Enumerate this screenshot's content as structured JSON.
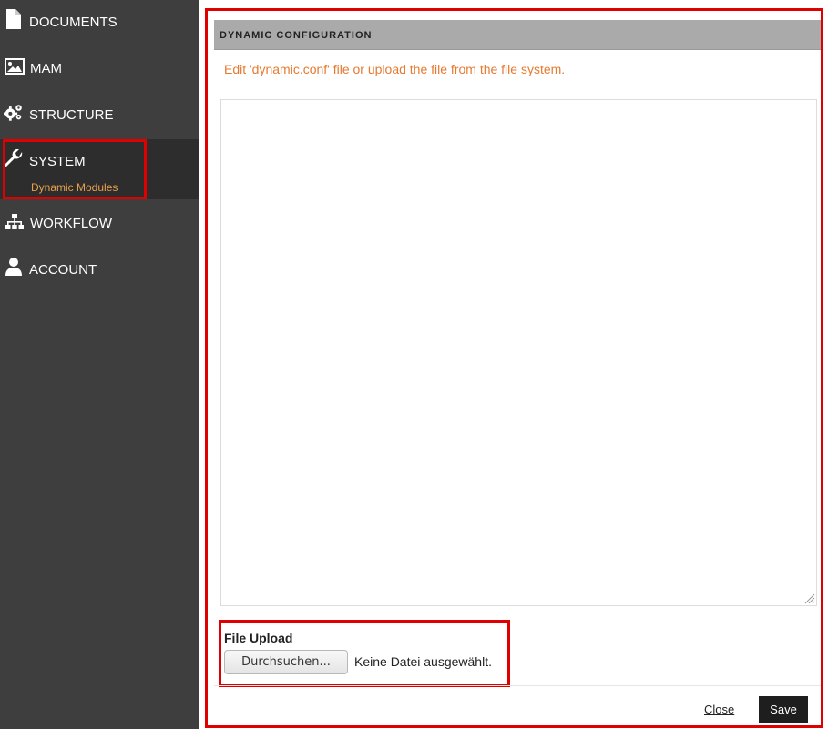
{
  "sidebar": {
    "items": [
      {
        "label": "DOCUMENTS",
        "icon": "document-icon"
      },
      {
        "label": "MAM",
        "icon": "image-icon"
      },
      {
        "label": "STRUCTURE",
        "icon": "gears-icon"
      },
      {
        "label": "SYSTEM",
        "icon": "wrench-icon",
        "active": true,
        "sub_items": [
          "Dynamic Modules"
        ]
      },
      {
        "label": "WORKFLOW",
        "icon": "sitemap-icon"
      },
      {
        "label": "ACCOUNT",
        "icon": "user-icon"
      }
    ]
  },
  "panel": {
    "title": "DYNAMIC CONFIGURATION",
    "intro": "Edit 'dynamic.conf' file or upload the file from the file system.",
    "textarea_value": "",
    "file_upload": {
      "label": "File Upload",
      "browse_label": "Durchsuchen...",
      "status": "Keine Datei ausgewählt."
    },
    "footer": {
      "close_label": "Close",
      "save_label": "Save"
    }
  },
  "colors": {
    "sidebar_bg": "#3e3e3e",
    "active_bg": "#2d2d2d",
    "sub_item": "#e8a04c",
    "intro_text": "#e57a30",
    "header_bg": "#aaaaaa",
    "highlight": "#e00000",
    "save_bg": "#1e1e1e"
  }
}
